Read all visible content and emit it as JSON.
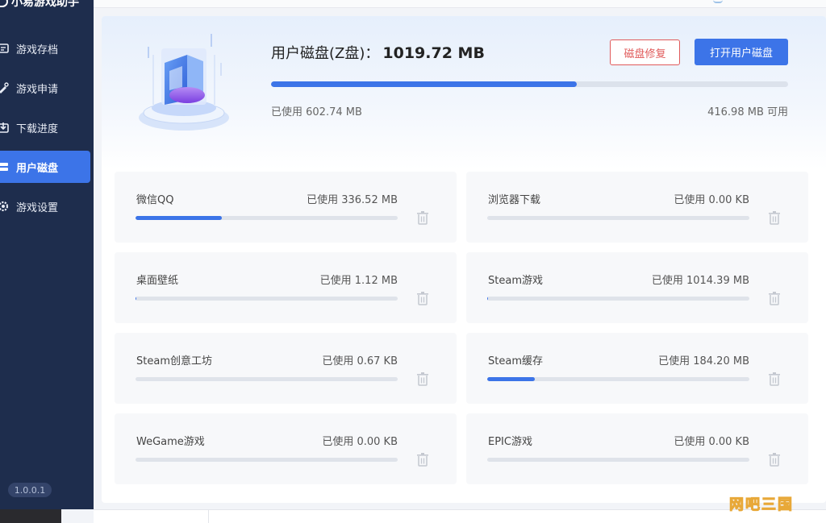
{
  "app": {
    "title": "小易游戏助手",
    "version": "1.0.0.1"
  },
  "sidebar": {
    "items": [
      {
        "label": "游戏存档",
        "icon": "save-archive-icon"
      },
      {
        "label": "游戏申请",
        "icon": "apply-icon"
      },
      {
        "label": "下载进度",
        "icon": "download-progress-icon"
      },
      {
        "label": "用户磁盘",
        "icon": "disk-icon",
        "active": true
      },
      {
        "label": "游戏设置",
        "icon": "gear-icon"
      }
    ]
  },
  "disk": {
    "title": "用户磁盘(Z盘)：",
    "total": "1019.72 MB",
    "used_label": "已使用 602.74 MB",
    "free_label": "416.98 MB 可用",
    "used_fraction": 0.591,
    "repair_button": "磁盘修复",
    "open_button": "打开用户磁盘"
  },
  "folders": [
    {
      "name": "微信QQ",
      "usage": "已使用 336.52 MB",
      "fraction": 0.33
    },
    {
      "name": "浏览器下载",
      "usage": "已使用 0.00 KB",
      "fraction": 0
    },
    {
      "name": "桌面壁纸",
      "usage": "已使用 1.12 MB",
      "fraction": 0.004
    },
    {
      "name": "Steam游戏",
      "usage": "已使用 1014.39 MB",
      "fraction": 0.004
    },
    {
      "name": "Steam创意工坊",
      "usage": "已使用 0.67 KB",
      "fraction": 0
    },
    {
      "name": "Steam缓存",
      "usage": "已使用 184.20 MB",
      "fraction": 0.18
    },
    {
      "name": "WeGame游戏",
      "usage": "已使用 0.00 KB",
      "fraction": 0
    },
    {
      "name": "EPIC游戏",
      "usage": "已使用 0.00 KB",
      "fraction": 0
    }
  ],
  "watermark": "网吧三国",
  "colors": {
    "accent": "#3c74e8",
    "sidebar": "#1e2d4d",
    "danger": "#e05a5a"
  }
}
